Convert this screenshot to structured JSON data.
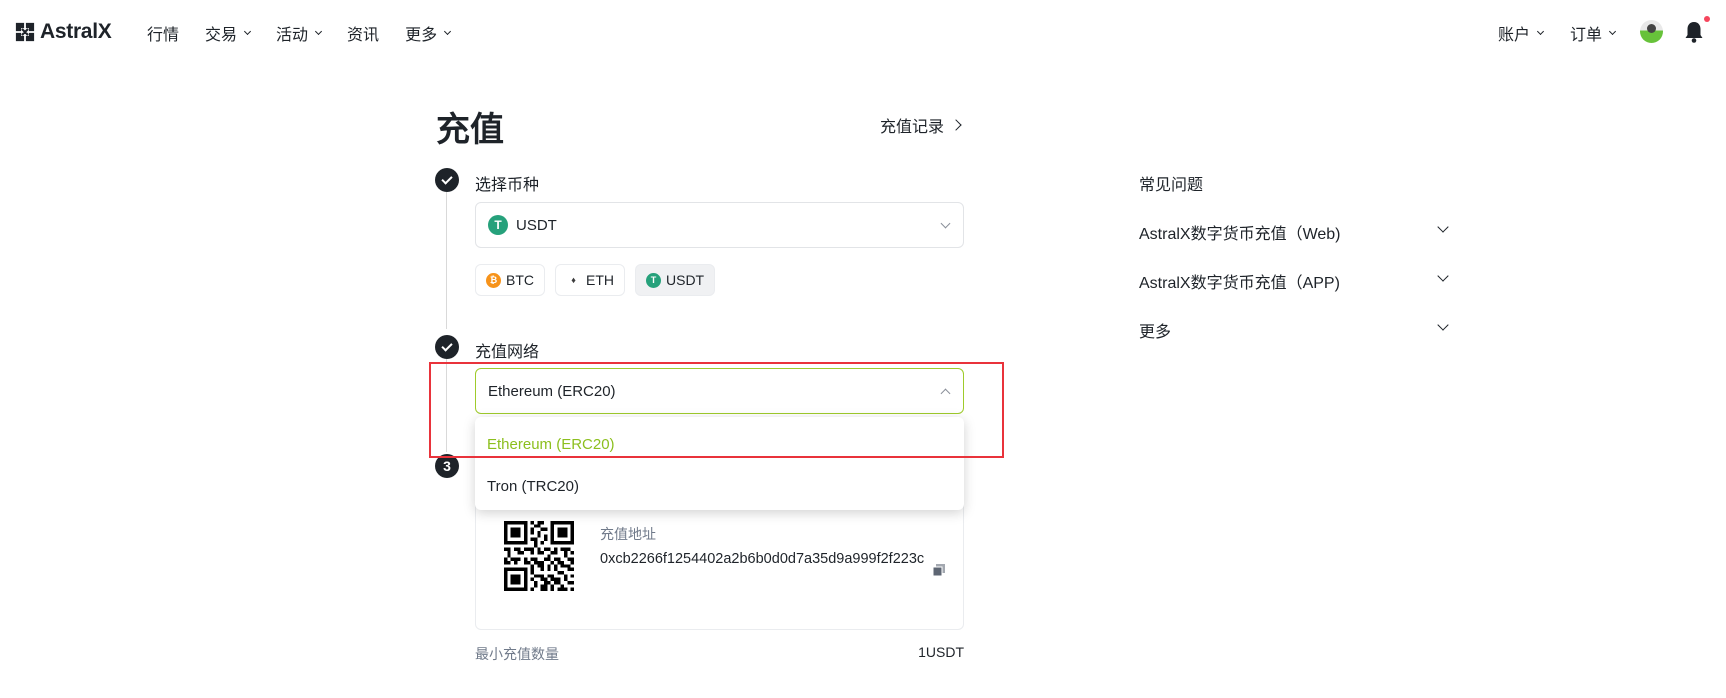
{
  "nav": {
    "logo": "AstralX",
    "left_items": [
      {
        "label": "行情",
        "dropdown": false
      },
      {
        "label": "交易",
        "dropdown": true
      },
      {
        "label": "活动",
        "dropdown": true
      },
      {
        "label": "资讯",
        "dropdown": false
      },
      {
        "label": "更多",
        "dropdown": true
      }
    ],
    "account": "账户",
    "orders": "订单",
    "notification_dot_color": "#f6465d"
  },
  "page": {
    "title": "充值",
    "history_link": "充值记录"
  },
  "steps": {
    "step1": {
      "label": "选择币种",
      "status": "done"
    },
    "step2": {
      "label": "充值网络",
      "status": "done"
    },
    "step3": {
      "number": "3"
    }
  },
  "coin_select": {
    "value": "USDT",
    "icon": "usdt-icon"
  },
  "coin_chips": [
    {
      "label": "BTC",
      "icon": "btc-icon",
      "selected": false
    },
    {
      "label": "ETH",
      "icon": "eth-icon",
      "selected": false
    },
    {
      "label": "USDT",
      "icon": "usdt-icon",
      "selected": true
    }
  ],
  "network_select": {
    "value": "Ethereum (ERC20)",
    "open": true,
    "options": [
      {
        "label": "Ethereum (ERC20)",
        "selected": true
      },
      {
        "label": "Tron (TRC20)",
        "selected": false
      }
    ]
  },
  "deposit": {
    "address_label": "充值地址",
    "address": "0xcb2266f1254402a2b6b0d0d7a35d9a999f2f223c",
    "min_label": "最小充值数量",
    "min_value": "1USDT"
  },
  "faq": {
    "title": "常见问题",
    "items": [
      {
        "label": "AstralX数字货币充值（Web)"
      },
      {
        "label": "AstralX数字货币充值（APP)"
      },
      {
        "label": "更多"
      }
    ]
  },
  "colors": {
    "accent_green": "#8cbf1e",
    "highlight_red": "#e9333b",
    "usdt": "#26a17b",
    "btc": "#f7931a"
  }
}
